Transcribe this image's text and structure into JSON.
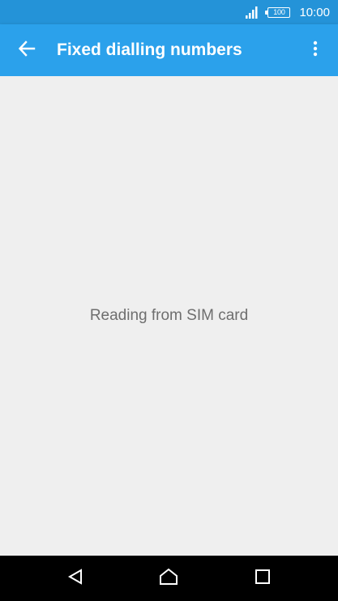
{
  "status_bar": {
    "time": "10:00",
    "battery_level": "100",
    "icons": [
      "signal-icon",
      "battery-icon"
    ]
  },
  "app_bar": {
    "title": "Fixed dialling numbers",
    "icons": [
      "back-arrow-icon",
      "more-vert-icon"
    ]
  },
  "content": {
    "message": "Reading from SIM card"
  },
  "nav_bar": {
    "icons": [
      "nav-back-icon",
      "nav-home-icon",
      "nav-recents-icon"
    ]
  },
  "colors": {
    "status_bar": "#2493d8",
    "app_bar": "#2ba1eb",
    "background": "#efefef",
    "message_text": "#6e6e6e",
    "nav_bar": "#000000"
  }
}
